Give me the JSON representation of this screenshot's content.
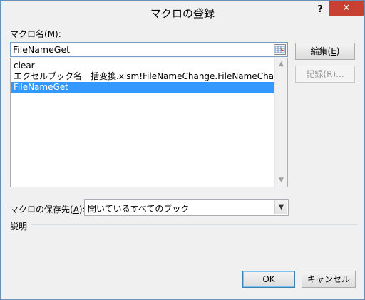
{
  "window": {
    "title": "マクロの登録",
    "help": "?",
    "close": "✕"
  },
  "macro_name": {
    "label_prefix": "マクロ名(",
    "label_key": "M",
    "label_suffix": "):",
    "value": "FileNameGet"
  },
  "macro_list": [
    {
      "text": "clear",
      "selected": false
    },
    {
      "text": "エクセルブック名一括変換.xlsm!FileNameChange.FileNameChange",
      "selected": false
    },
    {
      "text": "FileNameGet",
      "selected": true
    }
  ],
  "buttons": {
    "edit": {
      "prefix": "編集(",
      "key": "E",
      "suffix": ")"
    },
    "record": "記録(R)...",
    "ok": "OK",
    "cancel": "キャンセル"
  },
  "store_in": {
    "label_prefix": "マクロの保存先(",
    "label_key": "A",
    "label_suffix": "):",
    "value": "開いているすべてのブック"
  },
  "description": {
    "label": "説明"
  },
  "colors": {
    "selection": "#3399ff",
    "close_button": "#c84031"
  }
}
